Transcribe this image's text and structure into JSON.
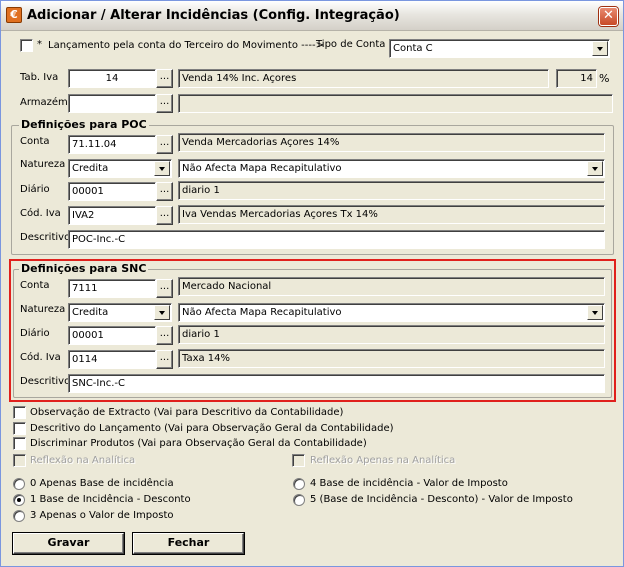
{
  "window": {
    "title": "Adicionar / Alterar Incidências (Config. Integração)",
    "close_glyph": "✕",
    "app_icon_glyph": "€"
  },
  "top": {
    "lancamento_label": "Lançamento pela conta do Terceiro do Movimento ---->",
    "lancamento_star": "*",
    "tipo_conta_label": "Tipo de Conta",
    "tipo_conta_value": "Conta C",
    "tab_iva_label": "Tab. Iva",
    "tab_iva_value": "14",
    "tab_iva_desc": "Venda 14% Inc. Açores",
    "tab_iva_rate": "14",
    "percent_sign": "%",
    "armazem_label": "Armazém",
    "armazem_value": "",
    "armazem_desc": "",
    "dots": "..."
  },
  "poc": {
    "title": "Definições para POC",
    "conta_label": "Conta",
    "conta_value": "71.11.04",
    "conta_desc": "Venda Mercadorias Açores 14%",
    "natureza_label": "Natureza",
    "natureza_value": "Credita",
    "natureza_mapa": "Não Afecta Mapa Recapitulativo",
    "diario_label": "Diário",
    "diario_value": "00001",
    "diario_desc": "diario 1",
    "cod_iva_label": "Cód. Iva",
    "cod_iva_value": "IVA2",
    "cod_iva_desc": "Iva Vendas Mercadorias Açores Tx 14%",
    "descritivo_label": "Descritivo",
    "descritivo_value": "POC-Inc.-C"
  },
  "snc": {
    "title": "Definições para SNC",
    "conta_label": "Conta",
    "conta_value": "7111",
    "conta_desc": "Mercado Nacional",
    "natureza_label": "Natureza",
    "natureza_value": "Credita",
    "natureza_mapa": "Não Afecta Mapa Recapitulativo",
    "diario_label": "Diário",
    "diario_value": "00001",
    "diario_desc": "diario 1",
    "cod_iva_label": "Cód. Iva",
    "cod_iva_value": "0114",
    "cod_iva_desc": "Taxa 14%",
    "descritivo_label": "Descritivo",
    "descritivo_value": "SNC-Inc.-C"
  },
  "options": {
    "obs_extracto": "Observação de Extracto (Vai para Descritivo da Contabilidade)",
    "desc_lancamento": "Descritivo do Lançamento (Vai para Observação Geral da Contabilidade)",
    "discriminar": "Discriminar Produtos (Vai para Observação Geral da Contabilidade)",
    "reflexao": "Reflexão na Analítica",
    "reflexao_apenas": "Reflexão Apenas na Analítica"
  },
  "radios": {
    "r0": "0 Apenas Base de incidência",
    "r1": "1 Base de Incidência - Desconto",
    "r3": "3 Apenas o Valor de Imposto",
    "r4": "4 Base de incidência - Valor de Imposto",
    "r5": "5 (Base de Incidência - Desconto) - Valor de Imposto",
    "selected": "r1"
  },
  "buttons": {
    "gravar": "Gravar",
    "fechar": "Fechar"
  },
  "colors": {
    "highlight_border": "#e0201c",
    "window_bg": "#ece9d8"
  }
}
